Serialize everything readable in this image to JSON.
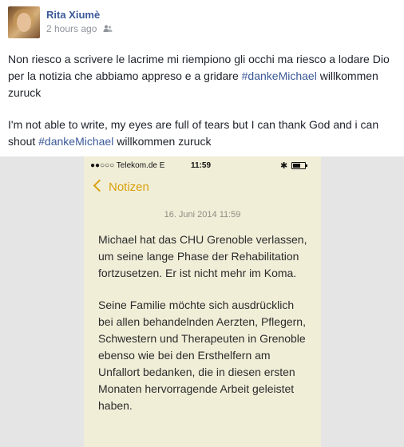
{
  "post": {
    "author": "Rita Xiumè",
    "timestamp": "2 hours ago",
    "audience_icon": "friends-icon",
    "text_it_before_tag": "Non riesco a scrivere le lacrime mi riempiono gli occhi ma riesco a lodare Dio per la notizia che abbiamo appreso e a gridare ",
    "hashtag_1": "#dankeMichael",
    "text_it_after_tag": " willkommen zuruck",
    "text_en_before_tag": "I'm not able to write, my eyes are full of tears but I can thank God and i can shout ",
    "hashtag_2": "#dankeMichael",
    "text_en_after_tag": " willkommen zuruck"
  },
  "phone": {
    "carrier": "●●○○○ Telekom.de  E",
    "time": "11:59",
    "bluetooth_icon": "bluetooth-icon",
    "battery_icon": "battery-icon",
    "back_label": "Notizen",
    "note_date": "16. Juni 2014 11:59",
    "paragraphs": [
      "Michael hat das CHU Grenoble verlassen, um seine lange Phase der Rehabilitation fortzusetzen. Er ist nicht mehr im Koma.",
      "Seine Familie möchte sich ausdrücklich bei allen behandelnden Aerzten, Pflegern, Schwestern und Therapeuten in Grenoble ebenso wie bei den Ersthelfern am Unfallort bedanken, die in diesen ersten Monaten hervorragende Arbeit geleistet haben."
    ]
  },
  "colors": {
    "link": "#3b5998",
    "notes_accent": "#d8a10b",
    "notes_paper": "#f1eed8"
  }
}
